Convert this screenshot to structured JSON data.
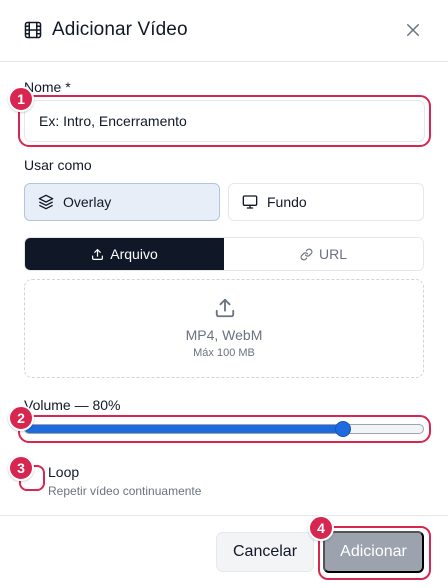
{
  "dialog": {
    "title": "Adicionar Vídeo",
    "icon": "film-icon",
    "close_icon": "close-icon"
  },
  "name_field": {
    "label": "Nome *",
    "placeholder": "Ex: Intro, Encerramento"
  },
  "usage": {
    "label": "Usar como",
    "options": [
      {
        "label": "Overlay",
        "icon": "layers-icon",
        "selected": true
      },
      {
        "label": "Fundo",
        "icon": "monitor-icon",
        "selected": false
      }
    ]
  },
  "source_tabs": [
    {
      "label": "Arquivo",
      "icon": "upload-icon",
      "active": true
    },
    {
      "label": "URL",
      "icon": "link-icon",
      "active": false
    }
  ],
  "dropzone": {
    "formats": "MP4, WebM",
    "max_size": "Máx 100 MB",
    "icon": "upload-icon"
  },
  "volume": {
    "label": "Volume — 80%",
    "value_fraction": 0.8
  },
  "loop": {
    "label": "Loop",
    "description": "Repetir vídeo continuamente",
    "checked": false
  },
  "footer": {
    "cancel_label": "Cancelar",
    "submit_label": "Adicionar"
  },
  "markers": [
    "1",
    "2",
    "3",
    "4"
  ],
  "colors": {
    "accent": "#1e6adf",
    "highlight": "#d7264f",
    "active_tab": "#101828",
    "disabled_button": "#9ca3af"
  }
}
